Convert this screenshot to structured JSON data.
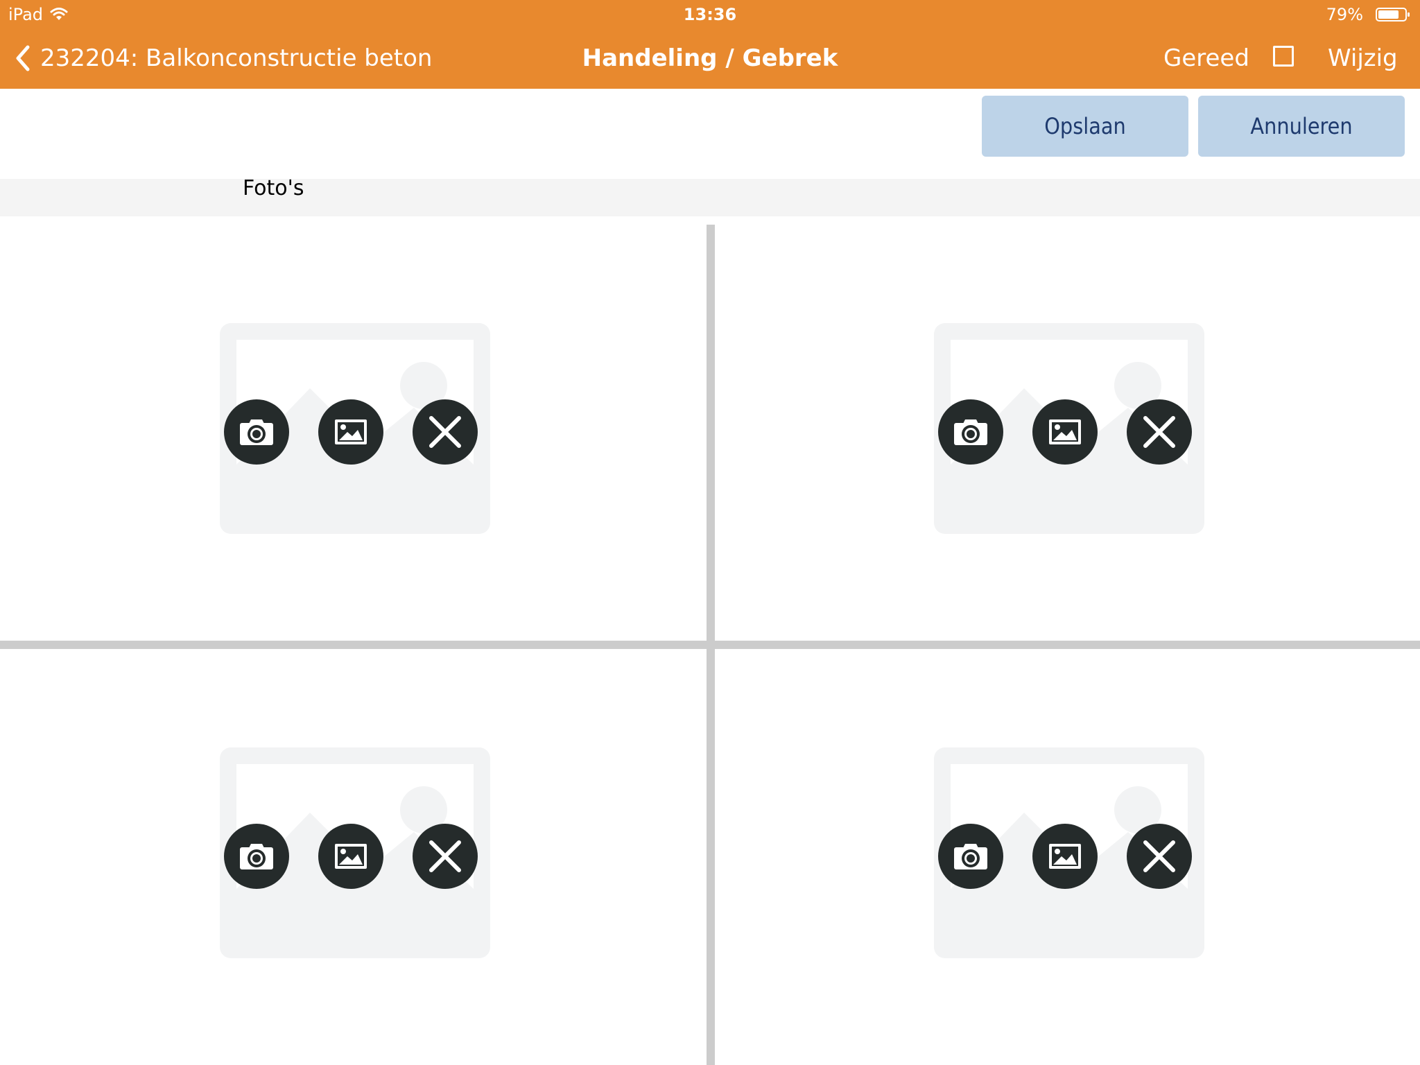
{
  "status_bar": {
    "device": "iPad",
    "time": "13:36",
    "battery": "79%"
  },
  "nav": {
    "back_label": "232204: Balkonconstructie beton",
    "title": "Handeling / Gebrek",
    "done_label": "Gereed",
    "edit_label": "Wijzig"
  },
  "actions": {
    "save_label": "Opslaan",
    "cancel_label": "Annuleren"
  },
  "section": {
    "label": "Foto's"
  },
  "photo_slots": [
    {
      "buttons": [
        "camera-icon",
        "image-gallery-icon",
        "close-icon"
      ]
    },
    {
      "buttons": [
        "camera-icon",
        "image-gallery-icon",
        "close-icon"
      ]
    },
    {
      "buttons": [
        "camera-icon",
        "image-gallery-icon",
        "close-icon"
      ]
    },
    {
      "buttons": [
        "camera-icon",
        "image-gallery-icon",
        "close-icon"
      ]
    }
  ],
  "colors": {
    "header": "#E8892E",
    "action_button": "#BDD3E8",
    "action_text": "#1E3A6E",
    "icon_button": "#252B2B",
    "divider": "#CCCCCC"
  }
}
